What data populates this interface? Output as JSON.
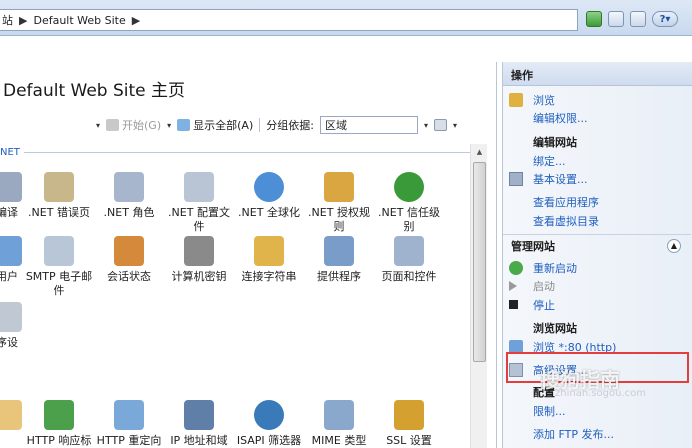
{
  "address": {
    "segment1": "站",
    "segment2": "Default Web Site"
  },
  "page_title": "Default Web Site 主页",
  "filterbar": {
    "start_label": "开始(G)",
    "show_all_label": "显示全部(A)",
    "group_by_label": "分组依据:",
    "group_by_value": "区域"
  },
  "group_header": "NET",
  "features_row1": [
    {
      "label": "编译",
      "color": "#9aa9bf"
    },
    {
      "label": ".NET 错误页",
      "color": "#c8b78a"
    },
    {
      "label": ".NET 角色",
      "color": "#a7b6cc"
    },
    {
      "label": ".NET 配置文件",
      "color": "#b9c4d4"
    },
    {
      "label": ".NET 全球化",
      "color": "#4c8fd6"
    },
    {
      "label": ".NET 授权规则",
      "color": "#d9a642"
    },
    {
      "label": ".NET 信任级别",
      "color": "#3a9a3a"
    }
  ],
  "features_row2": [
    {
      "label": "用户",
      "color": "#6fa0d8"
    },
    {
      "label": "SMTP 电子邮件",
      "color": "#b8c6d8"
    },
    {
      "label": "会话状态",
      "color": "#d48a3a"
    },
    {
      "label": "计算机密钥",
      "color": "#8a8a8a"
    },
    {
      "label": "连接字符串",
      "color": "#e0b44a"
    },
    {
      "label": "提供程序",
      "color": "#7a9cc8"
    },
    {
      "label": "页面和控件",
      "color": "#9fb3cf"
    }
  ],
  "features_row3": [
    {
      "label": "序设",
      "color": "#c0c8d4"
    }
  ],
  "features_row4": [
    {
      "label": "",
      "color": "#e8c57a"
    },
    {
      "label": "HTTP 响应标",
      "color": "#4ca04c"
    },
    {
      "label": "HTTP 重定向",
      "color": "#7aa8d8"
    },
    {
      "label": "IP 地址和域",
      "color": "#5f7fa8"
    },
    {
      "label": "ISAPI 筛选器",
      "color": "#3a7ab8"
    },
    {
      "label": "MIME 类型",
      "color": "#8aa8cc"
    },
    {
      "label": "SSL 设置",
      "color": "#d4a030"
    }
  ],
  "actions": {
    "header": "操作",
    "browse": "浏览",
    "edit_permissions": "编辑权限...",
    "edit_site": "编辑网站",
    "bindings": "绑定...",
    "basic_settings": "基本设置...",
    "view_apps": "查看应用程序",
    "view_vdirs": "查看虚拟目录",
    "manage_site": "管理网站",
    "restart": "重新启动",
    "start": "启动",
    "stop": "停止",
    "browse_site": "浏览网站",
    "browse_port": "浏览 *:80 (http)",
    "advanced": "高级设置...",
    "config": "配置",
    "limits": "限制...",
    "add_ftp": "添加 FTP 发布..."
  },
  "watermark": {
    "text": "搜狗指南",
    "sub": "zhinan.sogou.com"
  }
}
